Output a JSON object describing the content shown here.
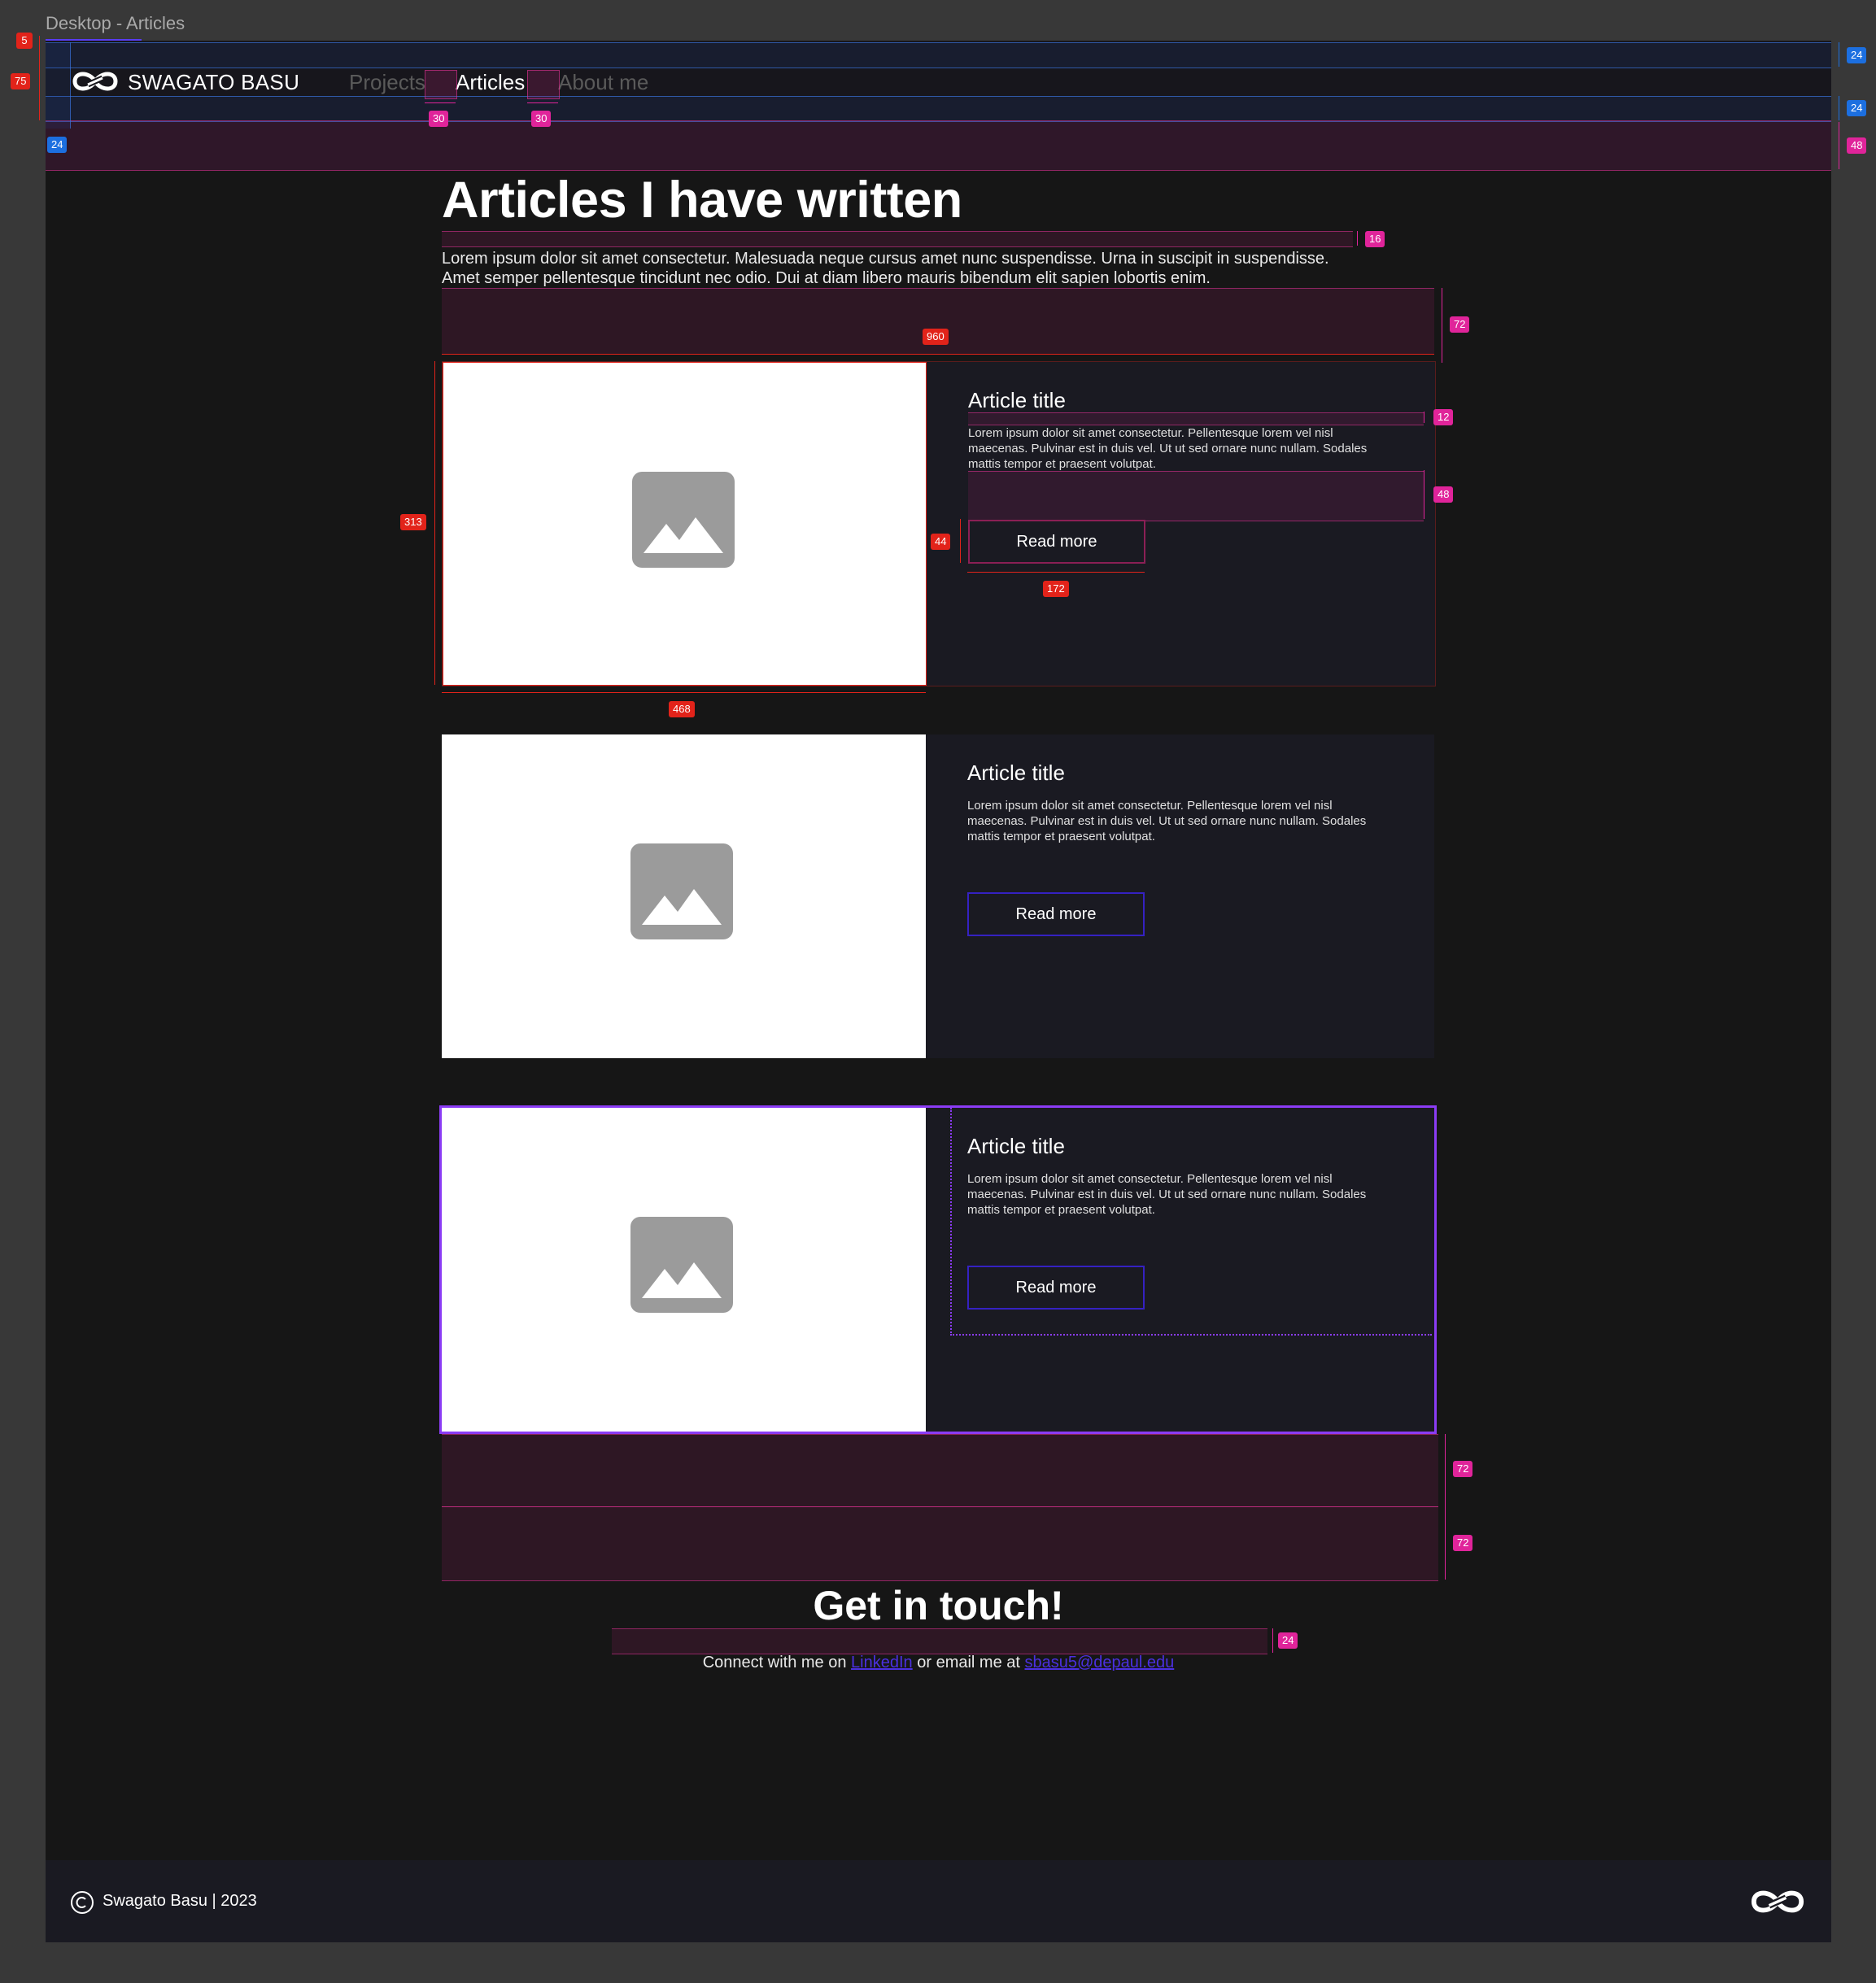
{
  "frame": {
    "label": "Desktop - Articles"
  },
  "nav": {
    "brand": "SWAGATO BASU",
    "links": [
      {
        "label": "Projects",
        "state": "inactive"
      },
      {
        "label": "Articles",
        "state": "active"
      },
      {
        "label": "About me",
        "state": "inactive"
      }
    ]
  },
  "intro": {
    "title": "Articles I have written",
    "line1": "Lorem ipsum dolor sit amet consectetur. Malesuada neque cursus amet nunc suspendisse. Urna in suscipit in suspendisse.",
    "line2": "Amet semper pellentesque tincidunt nec odio. Dui at diam libero mauris bibendum elit sapien lobortis enim."
  },
  "articles": [
    {
      "title": "Article title",
      "text": "Lorem ipsum dolor sit amet consectetur. Pellentesque lorem vel nisl maecenas. Pulvinar est in duis vel. Ut ut sed ornare nunc nullam. Sodales mattis tempor et praesent volutpat.",
      "button": "Read more",
      "image_icon": "image-placeholder-icon"
    },
    {
      "title": "Article title",
      "text": "Lorem ipsum dolor sit amet consectetur. Pellentesque lorem vel nisl maecenas. Pulvinar est in duis vel. Ut ut sed ornare nunc nullam. Sodales mattis tempor et praesent volutpat.",
      "button": "Read more",
      "image_icon": "image-placeholder-icon"
    },
    {
      "title": "Article title",
      "text": "Lorem ipsum dolor sit amet consectetur. Pellentesque lorem vel nisl maecenas. Pulvinar est in duis vel. Ut ut sed ornare nunc nullam. Sodales mattis tempor et praesent volutpat.",
      "button": "Read more",
      "image_icon": "image-placeholder-icon"
    }
  ],
  "contact": {
    "title": "Get in touch!",
    "prefix": "Connect with me on ",
    "linkedin": "LinkedIn",
    "middle": " or email me at ",
    "email": "sbasu5@depaul.edu"
  },
  "footer": {
    "copyright": "Swagato Basu | 2023",
    "copyright_icon": "copyright-icon",
    "logo_icon": "infinity-logo-icon"
  },
  "annotations": {
    "frame_top": "5",
    "nav_height": "75",
    "nav_pad_top": "24",
    "nav_pad_bottom": "24",
    "nav_pad_left": "24",
    "nav_gap_1": "30",
    "nav_gap_2": "30",
    "nav_margin_bottom": "48",
    "title_gap": "16",
    "intro_gap": "72",
    "content_width": "960",
    "card_height": "313",
    "card_img_width": "468",
    "card_title_gap": "12",
    "card_text_gap": "48",
    "button_height": "44",
    "button_width": "172",
    "section_gap_1": "72",
    "section_gap_2": "72",
    "contact_gap": "24"
  },
  "colors": {
    "accent": "#3521c2",
    "selection": "#8b3cf5",
    "link": "#4b30e0",
    "background": "#161616",
    "card": "#1a1a22"
  }
}
